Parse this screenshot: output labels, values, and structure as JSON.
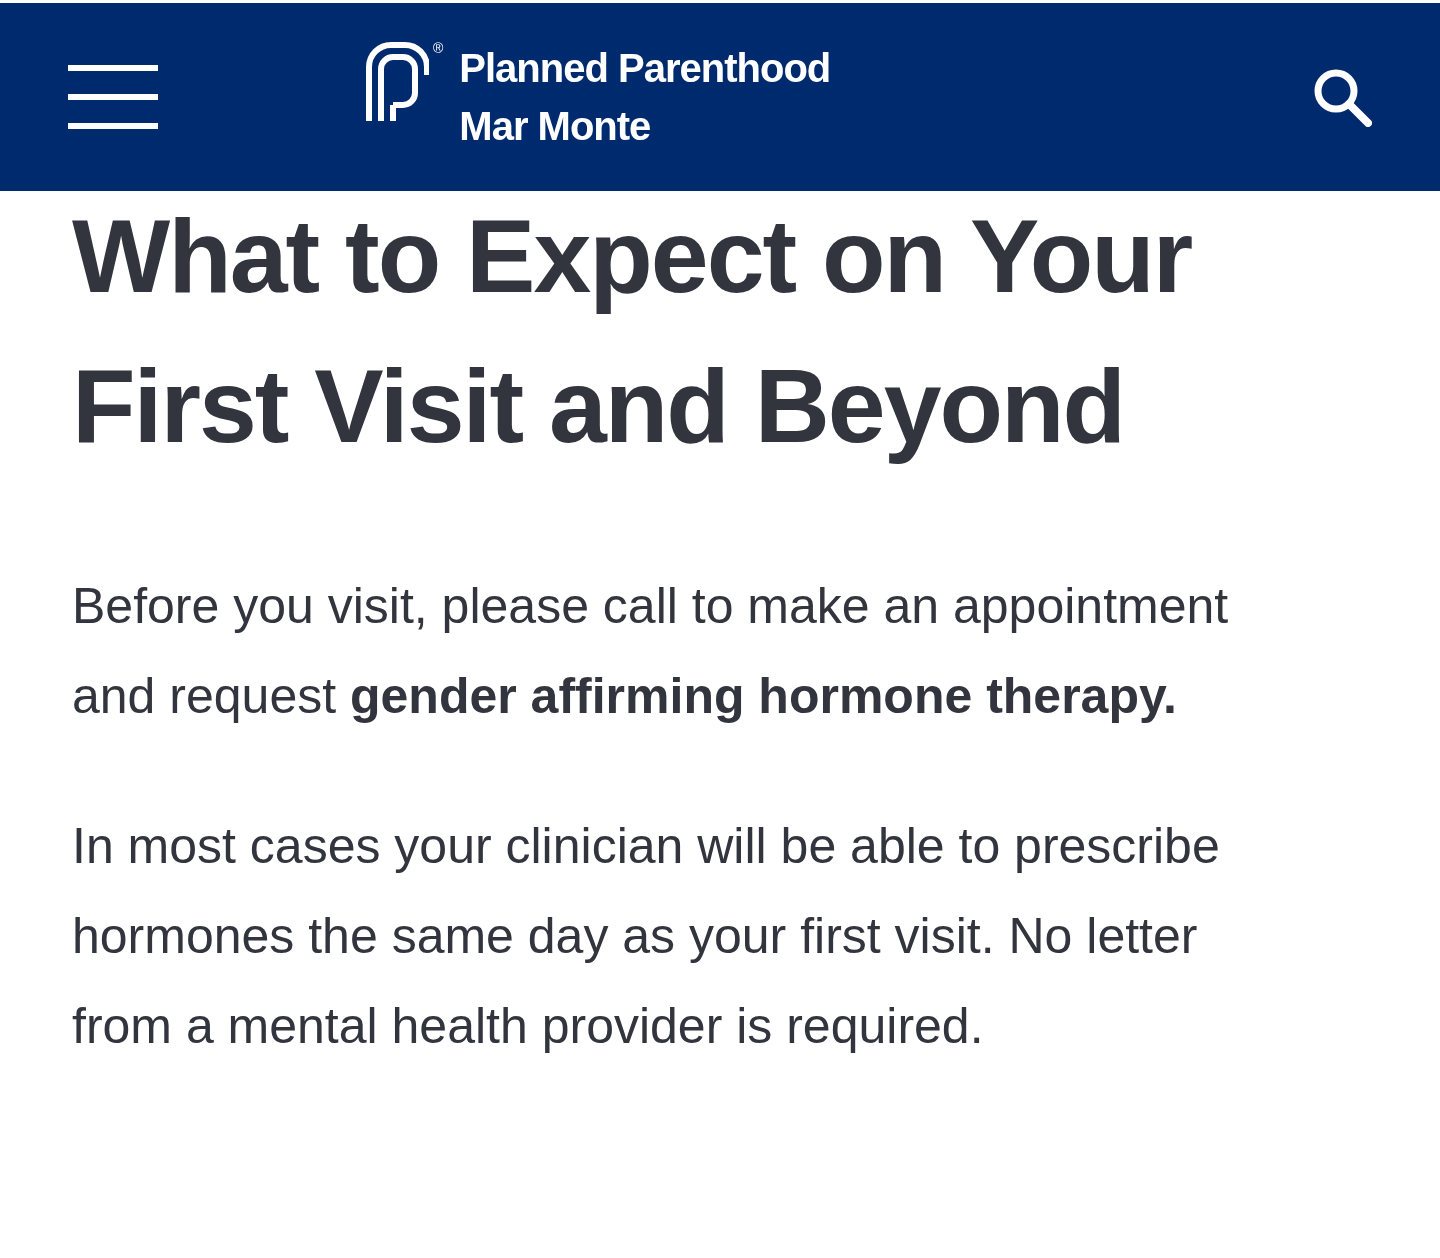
{
  "header": {
    "registered_mark": "®",
    "brand_lines": [
      "Planned Parenthood",
      "Mar Monte"
    ]
  },
  "title": "What to Expect on Your First Visit and Beyond",
  "paragraphs": [
    "Before you visit, please call to make an appointment and request **gender affirming hormone therapy.**",
    "In most cases your clinician will be able to prescribe hormones the same day as your first visit. No letter from a mental health provider is required."
  ]
}
